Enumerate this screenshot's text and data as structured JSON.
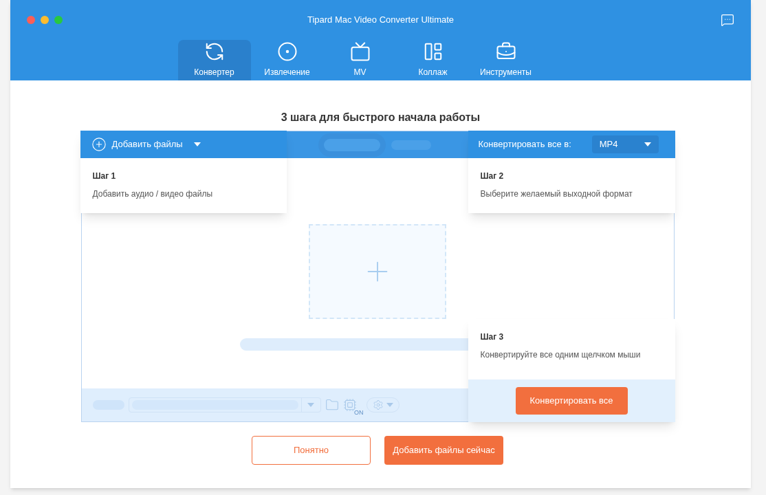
{
  "window": {
    "title": "Tipard Mac Video Converter Ultimate"
  },
  "tabs": [
    {
      "label": "Конвертер",
      "selected": true,
      "kind": "convert"
    },
    {
      "label": "Извлечение",
      "selected": false,
      "kind": "ripper"
    },
    {
      "label": "MV",
      "selected": false,
      "kind": "mv"
    },
    {
      "label": "Коллаж",
      "selected": false,
      "kind": "collage"
    },
    {
      "label": "Инструменты",
      "selected": false,
      "kind": "toolbox"
    }
  ],
  "heading": "3 шага для быстрого начала работы",
  "preview": {
    "accel_label": "ON"
  },
  "step1": {
    "add_button": "Добавить файлы",
    "title": "Шаг 1",
    "description": "Добавить аудио / видео файлы"
  },
  "step2": {
    "label": "Конвертировать все в:",
    "format": "MP4",
    "title": "Шаг 2",
    "description": "Выберите желаемый выходной формат"
  },
  "step3": {
    "title": "Шаг 3",
    "description": "Конвертируйте все одним щелчком мыши",
    "button": "Конвертировать все"
  },
  "buttons": [
    {
      "label": "Понятно",
      "kind": "outline"
    },
    {
      "label": "Добавить файлы сейчас",
      "kind": "primary"
    }
  ]
}
